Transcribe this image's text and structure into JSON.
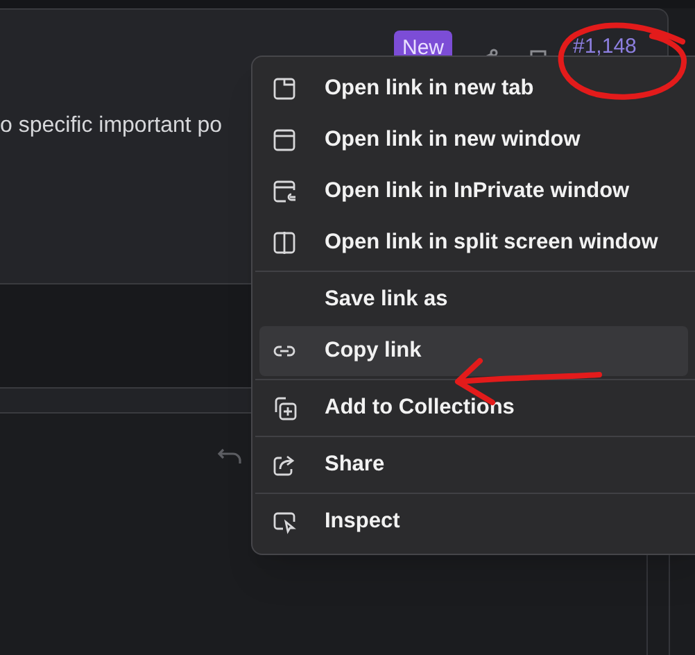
{
  "page": {
    "badge": "New",
    "issue_number": "#1,148",
    "body_text": "o specific important po"
  },
  "context_menu": {
    "groups": [
      [
        {
          "label": "Open link in new tab",
          "selected": false
        },
        {
          "label": "Open link in new window",
          "selected": false
        },
        {
          "label": "Open link in InPrivate window",
          "selected": false
        },
        {
          "label": "Open link in split screen window",
          "selected": false
        }
      ],
      [
        {
          "label": "Save link as",
          "selected": false
        },
        {
          "label": "Copy link",
          "selected": true
        }
      ],
      [
        {
          "label": "Add to Collections",
          "selected": false
        }
      ],
      [
        {
          "label": "Share",
          "selected": false
        }
      ],
      [
        {
          "label": "Inspect",
          "selected": false
        }
      ]
    ]
  }
}
